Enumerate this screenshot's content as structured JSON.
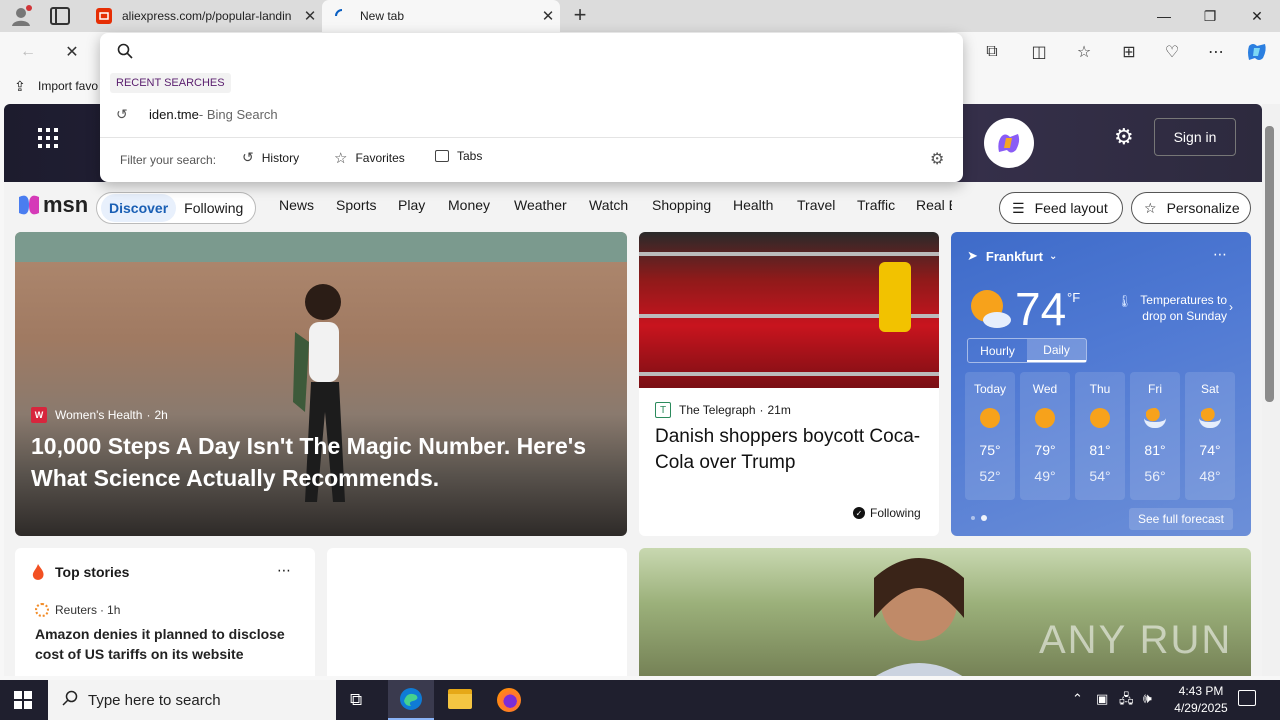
{
  "browser": {
    "tabs": [
      {
        "title": "aliexpress.com/p/popular-landin",
        "active": false
      },
      {
        "title": "New tab",
        "active": true
      }
    ],
    "favorites_bar": {
      "import_label": "Import favo"
    }
  },
  "omnibox": {
    "value": "",
    "recent_header": "RECENT SEARCHES",
    "recent": [
      {
        "query": "iden.tme",
        "suffix": " - Bing Search"
      }
    ],
    "filter_label": "Filter your search:",
    "filters": [
      "History",
      "Favorites",
      "Tabs"
    ]
  },
  "msn": {
    "logo": "msn",
    "sign_in": "Sign in",
    "tabs": {
      "discover": "Discover",
      "following": "Following"
    },
    "categories": [
      "News",
      "Sports",
      "Play",
      "Money",
      "Weather",
      "Watch",
      "Shopping",
      "Health",
      "Travel",
      "Traffic",
      "Real E"
    ],
    "feed_layout": "Feed layout",
    "personalize": "Personalize"
  },
  "hero_story": {
    "source": "Women's Health",
    "time": "2h",
    "headline": "10,000 Steps A Day Isn't The Magic Number. Here's What Science Actually Recommends."
  },
  "story2": {
    "source": "The Telegraph",
    "time": "21m",
    "headline": "Danish shoppers boycott Coca-Cola over Trump",
    "following": "Following"
  },
  "weather": {
    "city": "Frankfurt",
    "temp": "74",
    "unit": "°F",
    "alert": "Temperatures to drop on Sunday",
    "tabs": [
      "Hourly",
      "Daily"
    ],
    "days": [
      {
        "day": "Today",
        "hi": "75°",
        "lo": "52°"
      },
      {
        "day": "Wed",
        "hi": "79°",
        "lo": "49°"
      },
      {
        "day": "Thu",
        "hi": "81°",
        "lo": "54°"
      },
      {
        "day": "Fri",
        "hi": "81°",
        "lo": "56°"
      },
      {
        "day": "Sat",
        "hi": "74°",
        "lo": "48°"
      }
    ],
    "see_full": "See full forecast"
  },
  "top_stories": {
    "title": "Top stories",
    "source": "Reuters",
    "time": "1h",
    "headline": "Amazon denies it planned to disclose cost of US tariffs on its website"
  },
  "watermark": "ANY RUN",
  "taskbar": {
    "search_placeholder": "Type here to search",
    "time": "4:43 PM",
    "date": "4/29/2025"
  }
}
